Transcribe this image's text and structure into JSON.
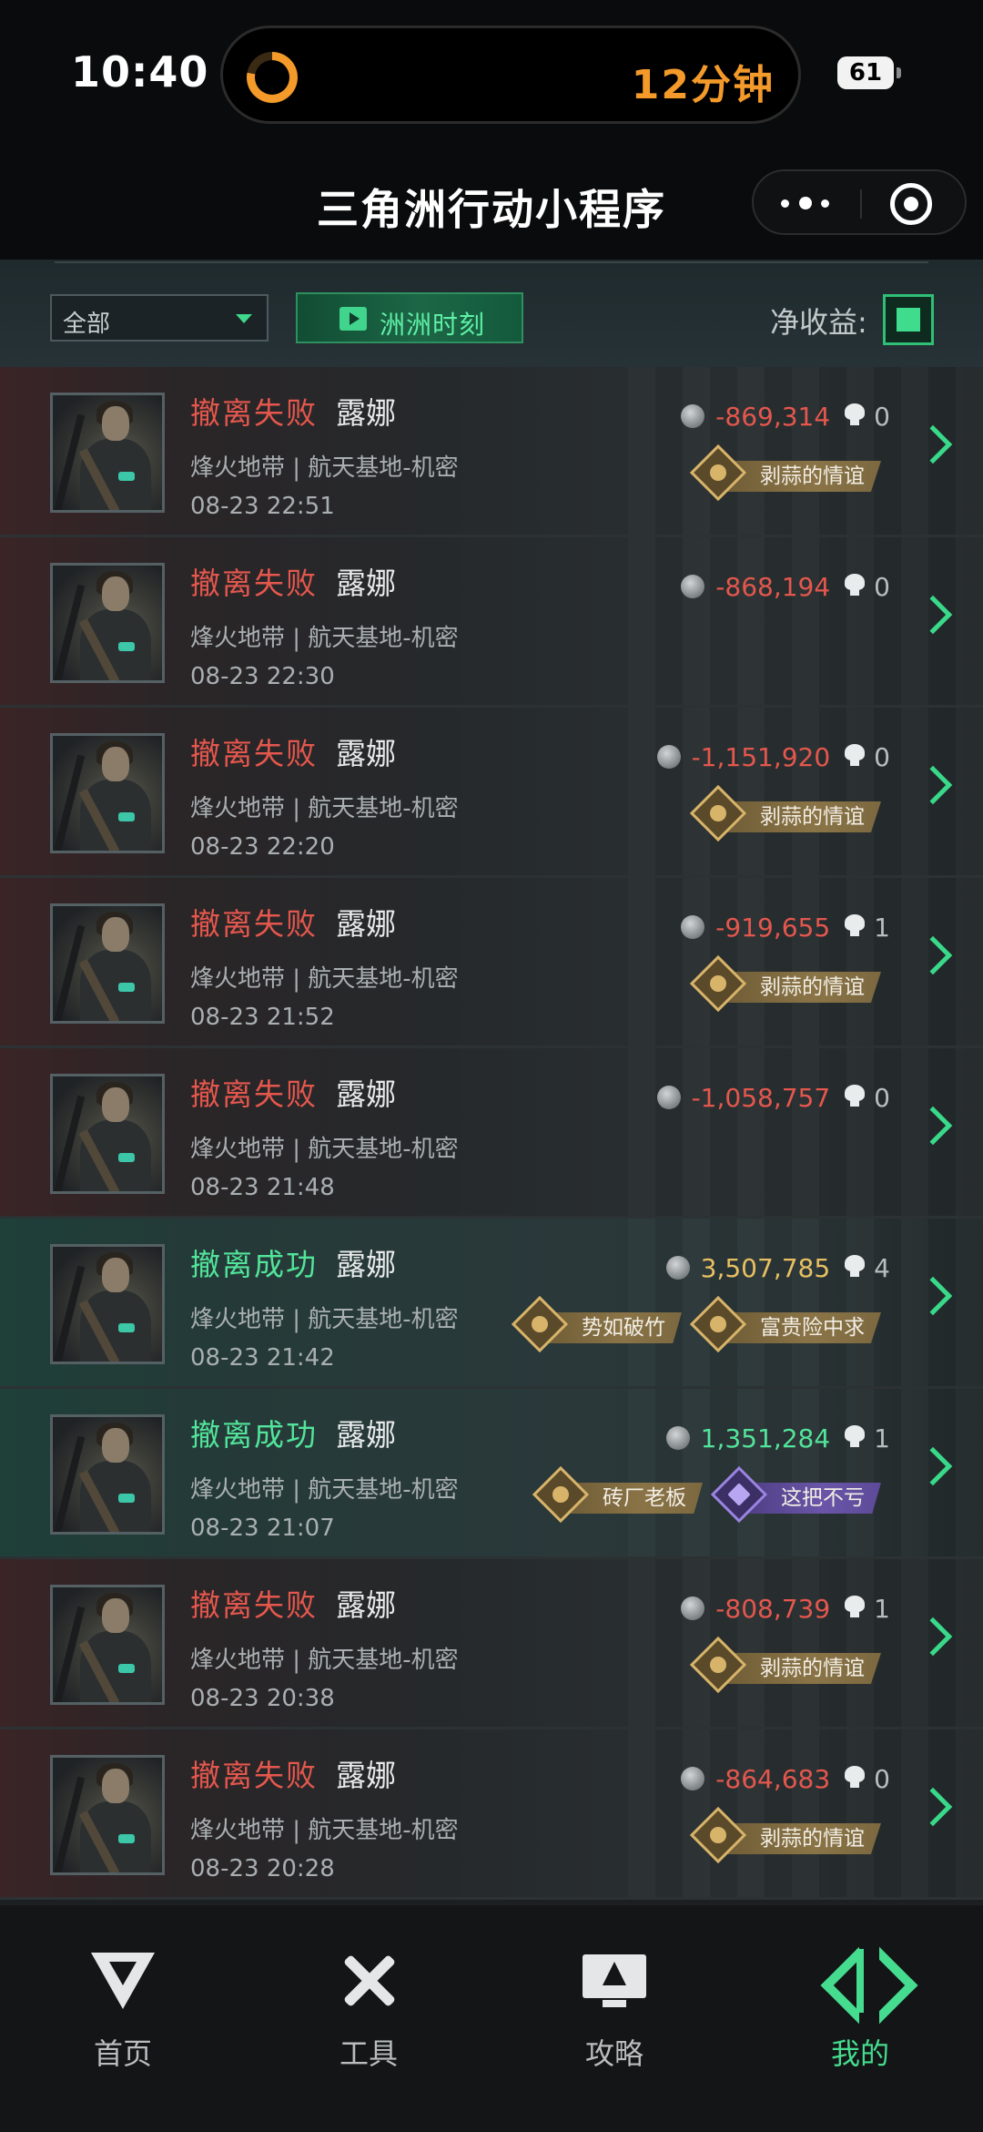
{
  "status_bar": {
    "time": "10:40",
    "island_text": "12分钟",
    "battery": "61",
    "ring_icon": "timer-ring-icon"
  },
  "title_bar": {
    "title": "三角洲行动小程序",
    "more_icon": "more-dots-icon",
    "close_icon": "target-circle-icon"
  },
  "filter": {
    "dropdown_value": "全部",
    "moment_button": "洲洲时刻",
    "net_income_label": "净收益:",
    "net_income_checked": true
  },
  "colors": {
    "fail": "#e4574d",
    "success": "#52e49a",
    "accent": "#39d98a",
    "gold_value": "#e8c061"
  },
  "matches": [
    {
      "result": "撤离失败",
      "status": "fail",
      "operator": "露娜",
      "map": "烽火地带 | 航天基地-机密",
      "time": "08-23 22:51",
      "value": "-869,314",
      "value_style": "neg",
      "kills": "0",
      "badges": [
        {
          "label": "剥蒜的情谊",
          "style": "gold"
        }
      ]
    },
    {
      "result": "撤离失败",
      "status": "fail",
      "operator": "露娜",
      "map": "烽火地带 | 航天基地-机密",
      "time": "08-23 22:30",
      "value": "-868,194",
      "value_style": "neg",
      "kills": "0",
      "badges": []
    },
    {
      "result": "撤离失败",
      "status": "fail",
      "operator": "露娜",
      "map": "烽火地带 | 航天基地-机密",
      "time": "08-23 22:20",
      "value": "-1,151,920",
      "value_style": "neg",
      "kills": "0",
      "badges": [
        {
          "label": "剥蒜的情谊",
          "style": "gold"
        }
      ]
    },
    {
      "result": "撤离失败",
      "status": "fail",
      "operator": "露娜",
      "map": "烽火地带 | 航天基地-机密",
      "time": "08-23 21:52",
      "value": "-919,655",
      "value_style": "neg",
      "kills": "1",
      "badges": [
        {
          "label": "剥蒜的情谊",
          "style": "gold"
        }
      ]
    },
    {
      "result": "撤离失败",
      "status": "fail",
      "operator": "露娜",
      "map": "烽火地带 | 航天基地-机密",
      "time": "08-23 21:48",
      "value": "-1,058,757",
      "value_style": "neg",
      "kills": "0",
      "badges": []
    },
    {
      "result": "撤离成功",
      "status": "success",
      "operator": "露娜",
      "map": "烽火地带 | 航天基地-机密",
      "time": "08-23 21:42",
      "value": "3,507,785",
      "value_style": "gold",
      "kills": "4",
      "badges": [
        {
          "label": "势如破竹",
          "style": "gold"
        },
        {
          "label": "富贵险中求",
          "style": "gold"
        }
      ]
    },
    {
      "result": "撤离成功",
      "status": "success",
      "operator": "露娜",
      "map": "烽火地带 | 航天基地-机密",
      "time": "08-23 21:07",
      "value": "1,351,284",
      "value_style": "green",
      "kills": "1",
      "badges": [
        {
          "label": "砖厂老板",
          "style": "gold"
        },
        {
          "label": "这把不亏",
          "style": "purple"
        }
      ]
    },
    {
      "result": "撤离失败",
      "status": "fail",
      "operator": "露娜",
      "map": "烽火地带 | 航天基地-机密",
      "time": "08-23 20:38",
      "value": "-808,739",
      "value_style": "neg",
      "kills": "1",
      "badges": [
        {
          "label": "剥蒜的情谊",
          "style": "gold"
        }
      ]
    },
    {
      "result": "撤离失败",
      "status": "fail",
      "operator": "露娜",
      "map": "烽火地带 | 航天基地-机密",
      "time": "08-23 20:28",
      "value": "-864,683",
      "value_style": "neg",
      "kills": "0",
      "badges": [
        {
          "label": "剥蒜的情谊",
          "style": "gold"
        }
      ]
    }
  ],
  "tabs": [
    {
      "label": "首页",
      "icon": "home-icon",
      "active": false
    },
    {
      "label": "工具",
      "icon": "tools-icon",
      "active": false
    },
    {
      "label": "攻略",
      "icon": "guide-icon",
      "active": false
    },
    {
      "label": "我的",
      "icon": "mine-icon",
      "active": true
    }
  ]
}
